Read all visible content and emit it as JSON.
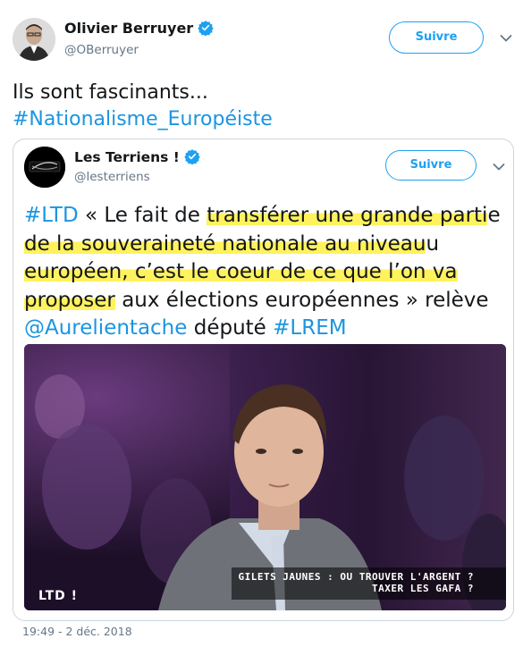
{
  "author": {
    "name": "Olivier Berruyer",
    "handle": "@OBerruyer",
    "follow_label": "Suivre"
  },
  "tweet": {
    "line1": "Ils sont fascinants...",
    "hashtag": "#Nationalisme_Européiste"
  },
  "quoted": {
    "name": "Les Terriens !",
    "handle": "@lesterriens",
    "follow_label": "Suivre",
    "avatar_text": "LES TERRIENS",
    "text": {
      "ltd": "#LTD",
      "t1": " « Le fait de ",
      "h1": "transférer une grande parti",
      "t2": "e ",
      "h2": "de la souveraineté nationale au niveau",
      "t3": "u ",
      "h3": "européen, c’est le coeur de ce que l’on va",
      "t4": " ",
      "h4": "proposer",
      "t5": " aux élections européennes » relève ",
      "mention": "@Aurelientache",
      "t6": " député ",
      "lrem": "#LREM"
    },
    "media": {
      "caption_line1": "GILETS JAUNES : OU TROUVER L'ARGENT ?",
      "caption_line2": "TAXER LES GAFA ?",
      "logo": "LTD !"
    }
  },
  "timestamp": "19:49 - 2 déc. 2018",
  "colors": {
    "link": "#1b95e0",
    "follow": "#1da1f2",
    "highlight": "#fff25c",
    "verified": "#1da1f2"
  }
}
